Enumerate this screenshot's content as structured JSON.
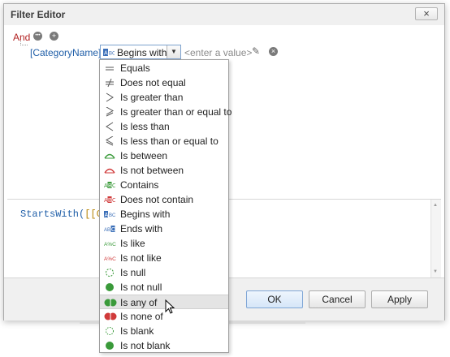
{
  "window": {
    "title": "Filter Editor",
    "close_glyph": "×"
  },
  "tree": {
    "group_operator": "And",
    "group_menu_glyph": "•••",
    "add_glyph": "+",
    "field": "[CategoryName]",
    "operator_icon": "ABC",
    "operator_label": "Begins with",
    "dropdown_arrow": "▼",
    "value_placeholder": "<enter a value>",
    "pencil_glyph": "✎",
    "remove_glyph": "×"
  },
  "expression": {
    "function": "StartsWith(",
    "bracket": "[[Cat"
  },
  "footer": {
    "ok": "OK",
    "cancel": "Cancel",
    "apply": "Apply"
  },
  "operators": [
    {
      "label": "Equals",
      "icon": "equals-icon"
    },
    {
      "label": "Does not equal",
      "icon": "not-equal-icon"
    },
    {
      "label": "Is greater than",
      "icon": "greater-than-icon"
    },
    {
      "label": "Is greater than or equal to",
      "icon": "greater-equal-icon"
    },
    {
      "label": "Is less than",
      "icon": "less-than-icon"
    },
    {
      "label": "Is less than or equal to",
      "icon": "less-equal-icon"
    },
    {
      "label": "Is between",
      "icon": "between-icon"
    },
    {
      "label": "Is not between",
      "icon": "not-between-icon"
    },
    {
      "label": "Contains",
      "icon": "contains-icon"
    },
    {
      "label": "Does not contain",
      "icon": "not-contain-icon"
    },
    {
      "label": "Begins with",
      "icon": "begins-with-icon"
    },
    {
      "label": "Ends with",
      "icon": "ends-with-icon"
    },
    {
      "label": "Is like",
      "icon": "like-icon"
    },
    {
      "label": "Is not like",
      "icon": "not-like-icon"
    },
    {
      "label": "Is null",
      "icon": "null-icon"
    },
    {
      "label": "Is not null",
      "icon": "not-null-icon"
    },
    {
      "label": "Is any of",
      "icon": "any-of-icon",
      "highlighted": true
    },
    {
      "label": "Is none of",
      "icon": "none-of-icon"
    },
    {
      "label": "Is blank",
      "icon": "blank-icon"
    },
    {
      "label": "Is not blank",
      "icon": "not-blank-icon"
    }
  ],
  "colors": {
    "accent_blue": "#1f5ea8",
    "red": "#b22222",
    "green": "#3a9a3a",
    "highlight": "#e4e4e4"
  }
}
